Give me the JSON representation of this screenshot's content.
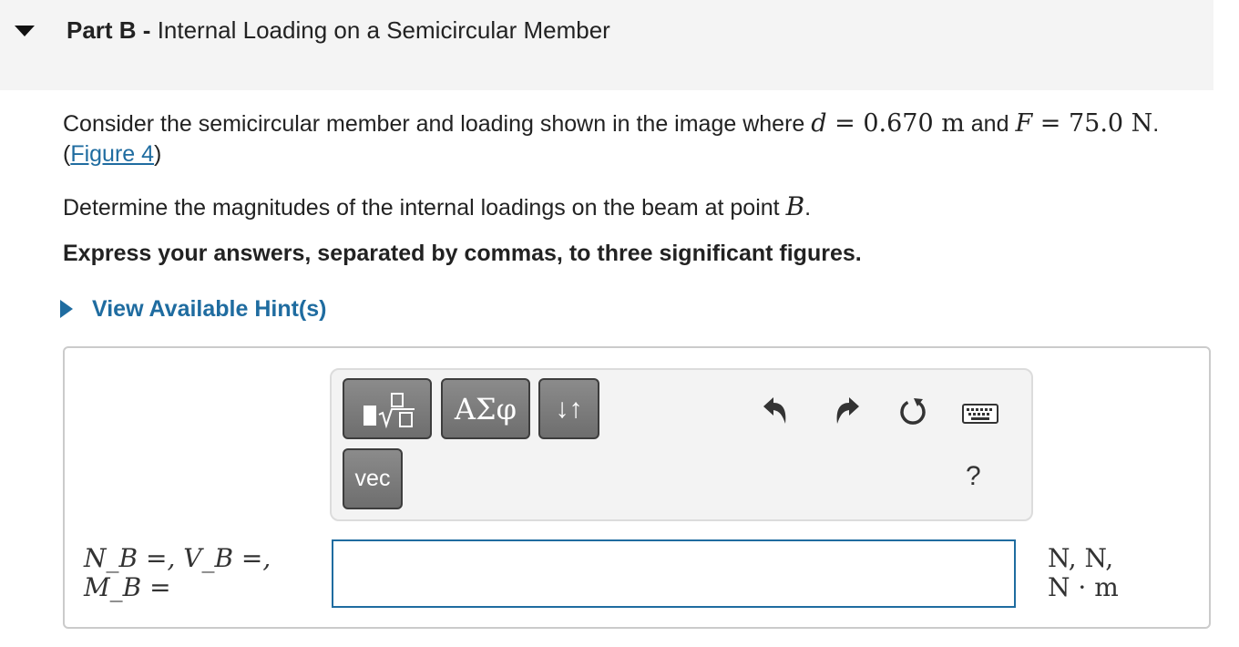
{
  "part": {
    "label": "Part B",
    "separator": " - ",
    "title": "Internal Loading on a Semicircular Member"
  },
  "problem": {
    "intro": "Consider the semicircular member and loading shown in the image where ",
    "d_symbol": "d",
    "eq1": " = 0.670 m",
    "and_text": " and ",
    "F_symbol": "F",
    "eq2": " = 75.0 N",
    "period": ".",
    "figure_open": "(",
    "figure_link": "Figure 4",
    "figure_close": ")",
    "question_text": "Determine the magnitudes of the internal loadings on the beam at point ",
    "point": "B",
    "question_end": ".",
    "instruction": "Express your answers, separated by commas, to three significant figures."
  },
  "hint": {
    "label": "View Available Hint(s)"
  },
  "toolbar": {
    "greek_label": "ΑΣφ",
    "arrows_label": "↓↑",
    "vec_label": "vec",
    "help_label": "?"
  },
  "answer": {
    "var_line1": "N_B =, V_B =,",
    "var_line2": "M_B =",
    "input_value": "",
    "units_line1": "N, N,",
    "units_line2": "N · m"
  },
  "colors": {
    "link": "#1f6ca0",
    "header_bg": "#f4f4f4",
    "button_bg": "#7a7a7a"
  },
  "icons": [
    "caret-down-icon",
    "caret-right-icon",
    "templates-icon",
    "undo-icon",
    "redo-icon",
    "reset-icon",
    "keyboard-icon"
  ]
}
